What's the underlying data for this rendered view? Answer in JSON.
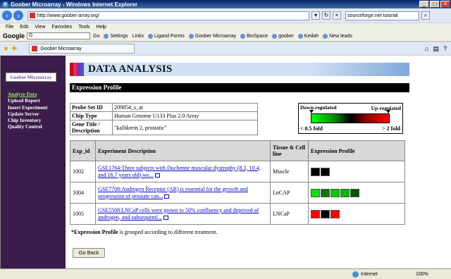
{
  "window": {
    "title": "Goober Microarray - Windows Internet Explorer"
  },
  "address": {
    "url": "http://www.goober-array.org/",
    "search_text": "sourceforge.net tutorial"
  },
  "menu": [
    "File",
    "Edit",
    "View",
    "Favorites",
    "Tools",
    "Help"
  ],
  "links_bar": {
    "google_label": "Google",
    "go_label": "Go",
    "settings_label": "Settings",
    "links_label": "Links",
    "items": [
      "Ligand Forms",
      "Goober Microarray",
      "BioSpace",
      "goober",
      "Kedah",
      "New leads"
    ]
  },
  "tab": {
    "label": "Goober Microarray"
  },
  "sidebar": {
    "logo": "Goober Microarray",
    "items": [
      {
        "label": "Analyze Data",
        "active": true
      },
      {
        "label": "Upload Report",
        "active": false
      },
      {
        "label": "Insert Experiment",
        "active": false
      },
      {
        "label": "Update Server",
        "active": false
      },
      {
        "label": "Chip Inventory",
        "active": false
      },
      {
        "label": "Quality Control",
        "active": false
      }
    ]
  },
  "page": {
    "title": "DATA ANALYSIS",
    "subheader": "Expression Profile",
    "info": [
      {
        "key": "Probe Set ID",
        "value": "209854_s_at"
      },
      {
        "key": "Chip Type",
        "value": "Human Genome U133 Plus 2.0 Array"
      },
      {
        "key": "Gene Title / Description",
        "value": "\"kallikrein 2, prostatic\""
      }
    ],
    "legend": {
      "down": "Down-regulated",
      "up": "Up-regulated",
      "low": "< 0.5 fold",
      "high": "> 2 fold"
    },
    "table": {
      "headers": [
        "Exp_id",
        "Experiment Description",
        "Tissue & Cell line",
        "Expression Profile"
      ],
      "rows": [
        {
          "exp_id": "1002",
          "description": "GSE1764:Three subjects with Duchenne muscular dystrophy (8.3, 10.4, and 16.7 years old) we...",
          "tissue": "Muscle",
          "profile": [
            "#000000",
            "#000000"
          ]
        },
        {
          "exp_id": "1004",
          "description": "GSE7708:Androgen Receptor (AR) is essential for the growth and progression of prostate can...",
          "tissue": "LnCAP",
          "profile": [
            "#00dd00",
            "#007700",
            "#00cc00",
            "#00bb00",
            "#005500"
          ]
        },
        {
          "exp_id": "1005",
          "description": "GSE5508:LNCaP cells were grown to 50% confluency and deprived of androgen, and subsequentl...",
          "tissue": "LNCaP",
          "profile": [
            "#ff0000",
            "#000000",
            "#ff0000"
          ]
        }
      ]
    },
    "footnote_bold": "*Expression Profile",
    "footnote_rest": " is grouped according to different treatment.",
    "back_button": "Go Back"
  },
  "status": {
    "text": "",
    "zone": "Internet",
    "zoom": "100%"
  }
}
